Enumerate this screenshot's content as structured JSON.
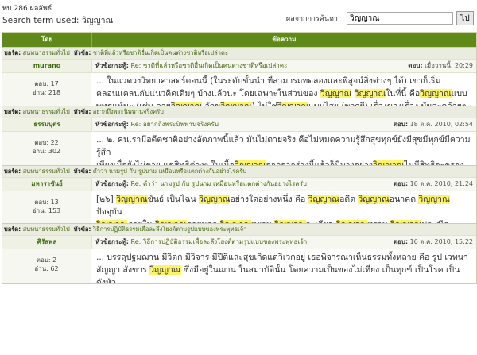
{
  "header": {
    "found_text": "พบ 286 ผลลัพธ์",
    "term_label": "Search term used:",
    "term_value": "วิญญาณ",
    "search_label": "ผลจากการค้นหา:",
    "search_value": "วิญญาณ",
    "go_label": "ไป"
  },
  "table": {
    "col_author": "โดย",
    "col_message": "ข้อความ"
  },
  "labels": {
    "board": "บอร์ด:",
    "topic": "หัวข้อ:",
    "subject": "หัวข้อกระทู้:",
    "posted": "ตอบ:",
    "replies": "ตอบ:",
    "views": "อ่าน:"
  },
  "posts": [
    {
      "board": "สนทนาธรรมทั่วไป",
      "topic": "ชาติที่แล้วหรือชาติอื่นเกิดเป็นคนต่างชาติหรือเปล่าคะ",
      "author": "murano",
      "replies": "17",
      "views": "218",
      "subject": "Re: ชาติที่แล้วหรือชาติอื่นเกิดเป็นคนต่างชาติหรือเปล่าคะ",
      "date": "เมื่อวานนี้, 20:29",
      "text": [
        "... ในแวดวงวิทยาศาสตร์ตอนนี้ (ในระดับขั้นนำ ที่สามารถทดลองและพิสูจน์สิ่งต่างๆ ได้) เขาก็เริ่ม",
        "คลอนแคลนกับแนวคิดเดิมๆ บ้างแล้วนะ โดยเฉพาะในส่วนของ [วิญญาณ] [วิญญาณ]ในที่นี้ คือ[วิญญาณ]แบบ",
        "พุทธแท้นะ (เช่น กาย[วิญญาณ] จักขุ[วิญญาณ]) ไม่ใช่[วิญญาณ]แบบไสย (พวกผี) เรื่องของเรื่อง มันจะคล้ายๆ",
        "สมัยที่เพิ่งค้นพบออกซิเจนน่ะ ..."
      ]
    },
    {
      "board": "สนทนาธรรมทั่วไป",
      "topic": "อยากถึงพระนิพพานจริงครับ",
      "author": "ธรรมบุตร",
      "replies": "22",
      "views": "302",
      "subject": "Re: อยากถึงพระนิพพานจริงครับ",
      "date": "18 ต.ค. 2010, 02:54",
      "text": [
        "... ๒. คนเรามีอดีตชาติอย่างอัตภาพนี้แล้ว มันไม่ตายจริง คือไม่หมดความรู้สึกสุขทุกข์ยังมีสุขมีทุกข์มีความรู้สึก",
        "เพียงเมื่อยังไม่ตาย แต่สิทธิต่างๆ ในเนื้อ[วิญญาณ]ออกจากร่างนี้แล้วก็มีบางอย่าง[วิญญาณ]ไม่มีสิทธิจะครอง",
        "บั้นที่อีก ทรัพย์สินที่พยายามสะสมไว้ตั้งแต่สมัยเมื่อยังทรงอัตภาพนี้ ส่วนอื่นนอกจากนี้ คือความสุขและความ",
        "ทุกข์ยังมีตามเดิม ..."
      ]
    },
    {
      "board": "สนทนาธรรมทั่วไป",
      "topic": "คำว่า นามรูป กับ รูปนาม เหมือนหรือแตกต่างกันอย่างไรครับ",
      "author": "มหาราชันย์",
      "replies": "13",
      "views": "153",
      "subject": "Re: คำว่า นามรูป กับ รูปนาม เหมือนหรือแตกต่างกันอย่างไรครับ",
      "date": "16 ต.ค. 2010, 21:24",
      "text": [
        "[๒๖] [วิญญาณ]ขันธ์ เป็นไฉน [วิญญาณ]อย่างใดอย่างหนึ่ง คือ [วิญญาณ]อดีต [วิญญาณ]อนาคต [วิญญาณ]ปัจจุบัน",
        "[วิญญาณ]ภายใน [วิญญาณ]ภายนอก [วิญญาณ]หยาบ [วิญญาณ]ละเอียด [วิญญาณ]ทราม [วิญญาณ]ประณีต",
        "[วิญญาณ]ไกล [วิญญาณ]ใกล้ ประมวลย่อเข้าเป็นกองเดียวกัน ..."
      ]
    },
    {
      "board": "สนทนาธรรมทั่วไป",
      "topic": "วิธีการปฏิบัติธรรมเพื่อละลึงโยงต์ตามรูปแบบของพระพุทธเจ้า",
      "author": "ศิรัสพล",
      "replies": "2",
      "views": "62",
      "subject": "Re: วิธีการปฏิบัติธรรมเพื่อละลึงโยงต์ตามรูปแบบของพระพุทธเจ้า",
      "date": "16 ต.ค. 2010, 15:22",
      "text": [
        "... บรรลุปฐมฌาน มีวิตก มีวิจาร มีปีติและสุขเกิดแต่วิเวกอยู่ เธอพิจารณาเห็นธรรมทั้งหลาย คือ รูป เวทนา",
        "สัญญา สังขาร [วิญญาณ] ซึ่งมีอยู่ในฌาน ในสมาบัตินั้น โดยความเป็นของไม่เที่ยง เป็นทุกข์ เป็นโรค เป็น ดังหัว",
        "ฝี เป็นดังลูกศร เป็นความลำบาก เป็นไข้ เป็นอื่น เป็นของทรุดโทรม ..."
      ]
    }
  ]
}
